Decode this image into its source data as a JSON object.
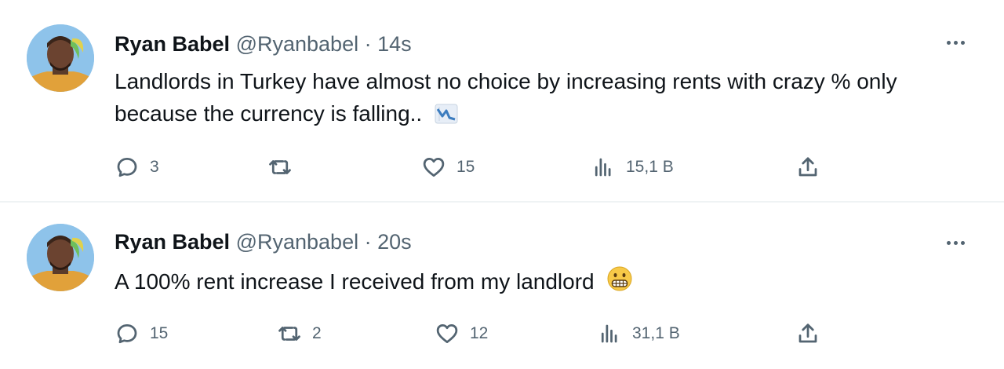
{
  "tweets": [
    {
      "name": "Ryan Babel",
      "handle": "@Ryanbabel",
      "separator": "·",
      "time": "14s",
      "text": "Landlords in Turkey have almost no choice by increasing rents with crazy % only because the currency is falling..",
      "emoji": "chart-decreasing-emoji",
      "actions": {
        "replies": "3",
        "reposts": "",
        "likes": "15",
        "views": "15,1 B"
      }
    },
    {
      "name": "Ryan Babel",
      "handle": "@Ryanbabel",
      "separator": "·",
      "time": "20s",
      "text": "A 100% rent increase I received from my landlord",
      "emoji": "grimacing-face-emoji",
      "actions": {
        "replies": "15",
        "reposts": "2",
        "likes": "12",
        "views": "31,1 B"
      }
    }
  ],
  "colors": {
    "text_primary": "#0f1419",
    "text_secondary": "#536471",
    "divider": "#eff3f4"
  },
  "icons": [
    "reply-icon",
    "repost-icon",
    "like-icon",
    "views-icon",
    "share-icon",
    "more-icon"
  ]
}
